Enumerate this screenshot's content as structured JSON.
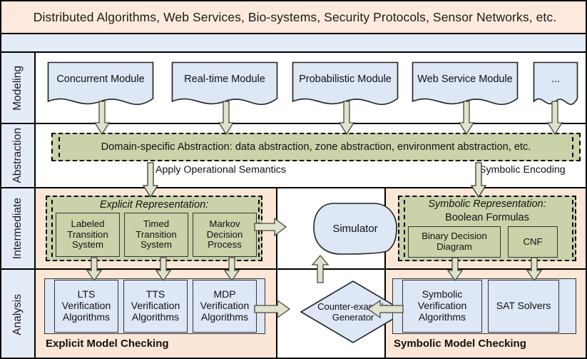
{
  "header": {
    "applications": "Distributed Algorithms, Web Services, Bio-systems, Security Protocols, Sensor Networks, etc."
  },
  "rows": [
    {
      "id": "modeling",
      "label": "Modeling"
    },
    {
      "id": "abstraction",
      "label": "Abstraction"
    },
    {
      "id": "intermediate",
      "label": "Intermediate"
    },
    {
      "id": "analysis",
      "label": "Analysis"
    }
  ],
  "modeling": {
    "modules": [
      {
        "label": "Concurrent Module"
      },
      {
        "label": "Real-time Module"
      },
      {
        "label": "Probabilistic Module"
      },
      {
        "label": "Web Service Module"
      },
      {
        "label": "..."
      }
    ]
  },
  "abstraction": {
    "bar_label": "Domain-specific Abstraction: data abstraction, zone abstraction, environment abstraction, etc.",
    "left_edge_label": "Apply Operational Semantics",
    "right_edge_label": "Symbolic Encoding"
  },
  "intermediate": {
    "explicit": {
      "title": "Explicit Representation:",
      "items": [
        {
          "label": "Labeled Transition System"
        },
        {
          "label": "Timed Transition System"
        },
        {
          "label": "Markov Decision Process"
        }
      ]
    },
    "simulator": {
      "label": "Simulator"
    },
    "symbolic": {
      "title": "Symbolic Representation:",
      "subtitle": "Boolean Formulas",
      "items": [
        {
          "label": "Binary Decision Diagram"
        },
        {
          "label": "CNF"
        }
      ]
    }
  },
  "analysis": {
    "explicit": {
      "title": "Explicit Model Checking",
      "items": [
        {
          "label": "LTS Verification Algorithms"
        },
        {
          "label": "TTS Verification Algorithms"
        },
        {
          "label": "MDP Verification Algorithms"
        }
      ]
    },
    "counterexample": {
      "label": "Counter-example Generator"
    },
    "symbolic": {
      "title": "Symbolic Model Checking",
      "items": [
        {
          "label": "Symbolic Verification Algorithms"
        },
        {
          "label": "SAT Solvers"
        }
      ]
    }
  },
  "colors": {
    "header_band": "#fdeadc",
    "strip_blue": "#e4ecf7",
    "peach": "#fce7d6",
    "green": "#c9d2a9",
    "blue_box": "#dde7f6",
    "arrow": "#dfe2cc",
    "outline": "#000000"
  }
}
